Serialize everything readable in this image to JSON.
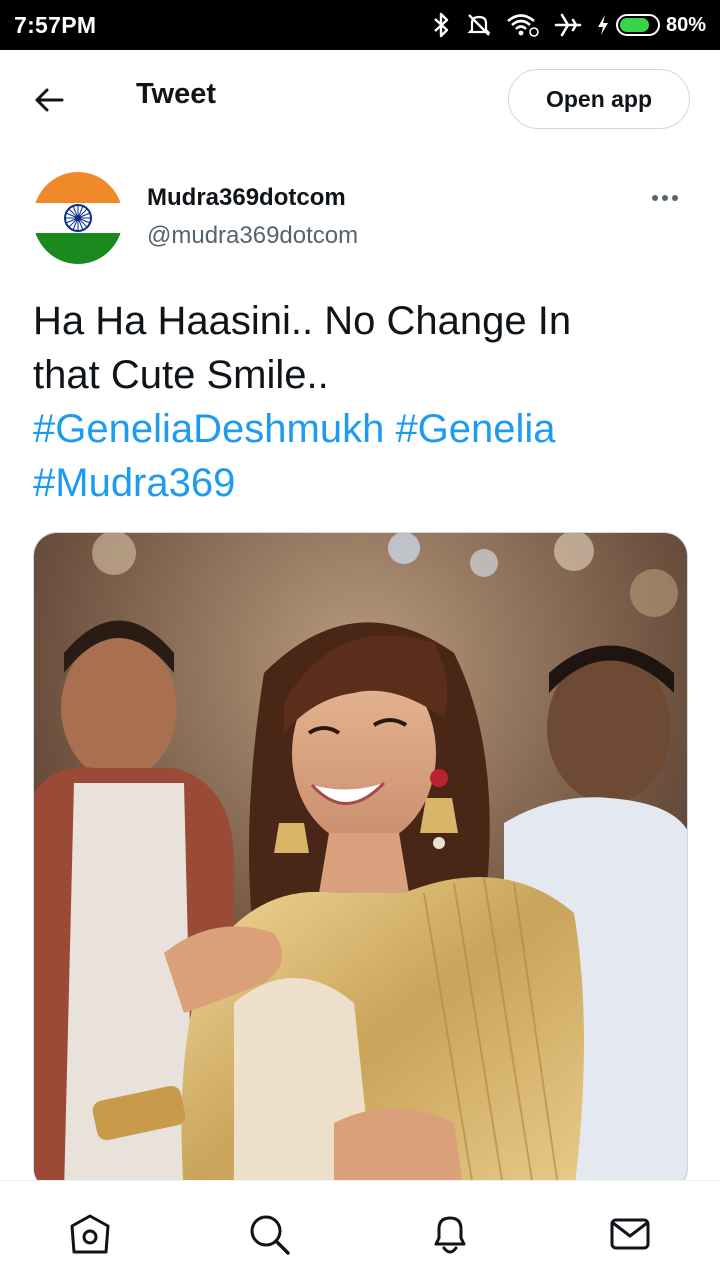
{
  "status_bar": {
    "time": "7:57PM",
    "battery_text": "80%",
    "battery_level": 0.8,
    "icons": [
      "bluetooth-icon",
      "mute-icon",
      "wifi-icon",
      "airplane-icon",
      "charging-icon",
      "battery-icon"
    ]
  },
  "header": {
    "title": "Tweet",
    "open_app_label": "Open app",
    "back_icon": "arrow-left-icon"
  },
  "tweet": {
    "author": {
      "display_name": "Mudra369dotcom",
      "handle": "@mudra369dotcom",
      "avatar": "indian-flag-avatar"
    },
    "text_lines": [
      "Ha Ha Haasini.. No Change In",
      "that Cute Smile.."
    ],
    "hashtags": [
      "#GeneliaDeshmukh",
      "#Genelia",
      "#Mudra369"
    ],
    "more_icon": "more-horizontal-icon",
    "media": "photo of smiling woman in gold outfit with jhumka earrings, crowd behind"
  },
  "bottom_nav": {
    "items": [
      "home-icon",
      "search-icon",
      "notifications-icon",
      "messages-icon"
    ]
  },
  "colors": {
    "link": "#1d9bf0",
    "text": "#0f1419",
    "secondary": "#536471",
    "border": "#cfd9de",
    "saffron": "#ff9933",
    "green": "#138808",
    "chakra": "#000080"
  }
}
